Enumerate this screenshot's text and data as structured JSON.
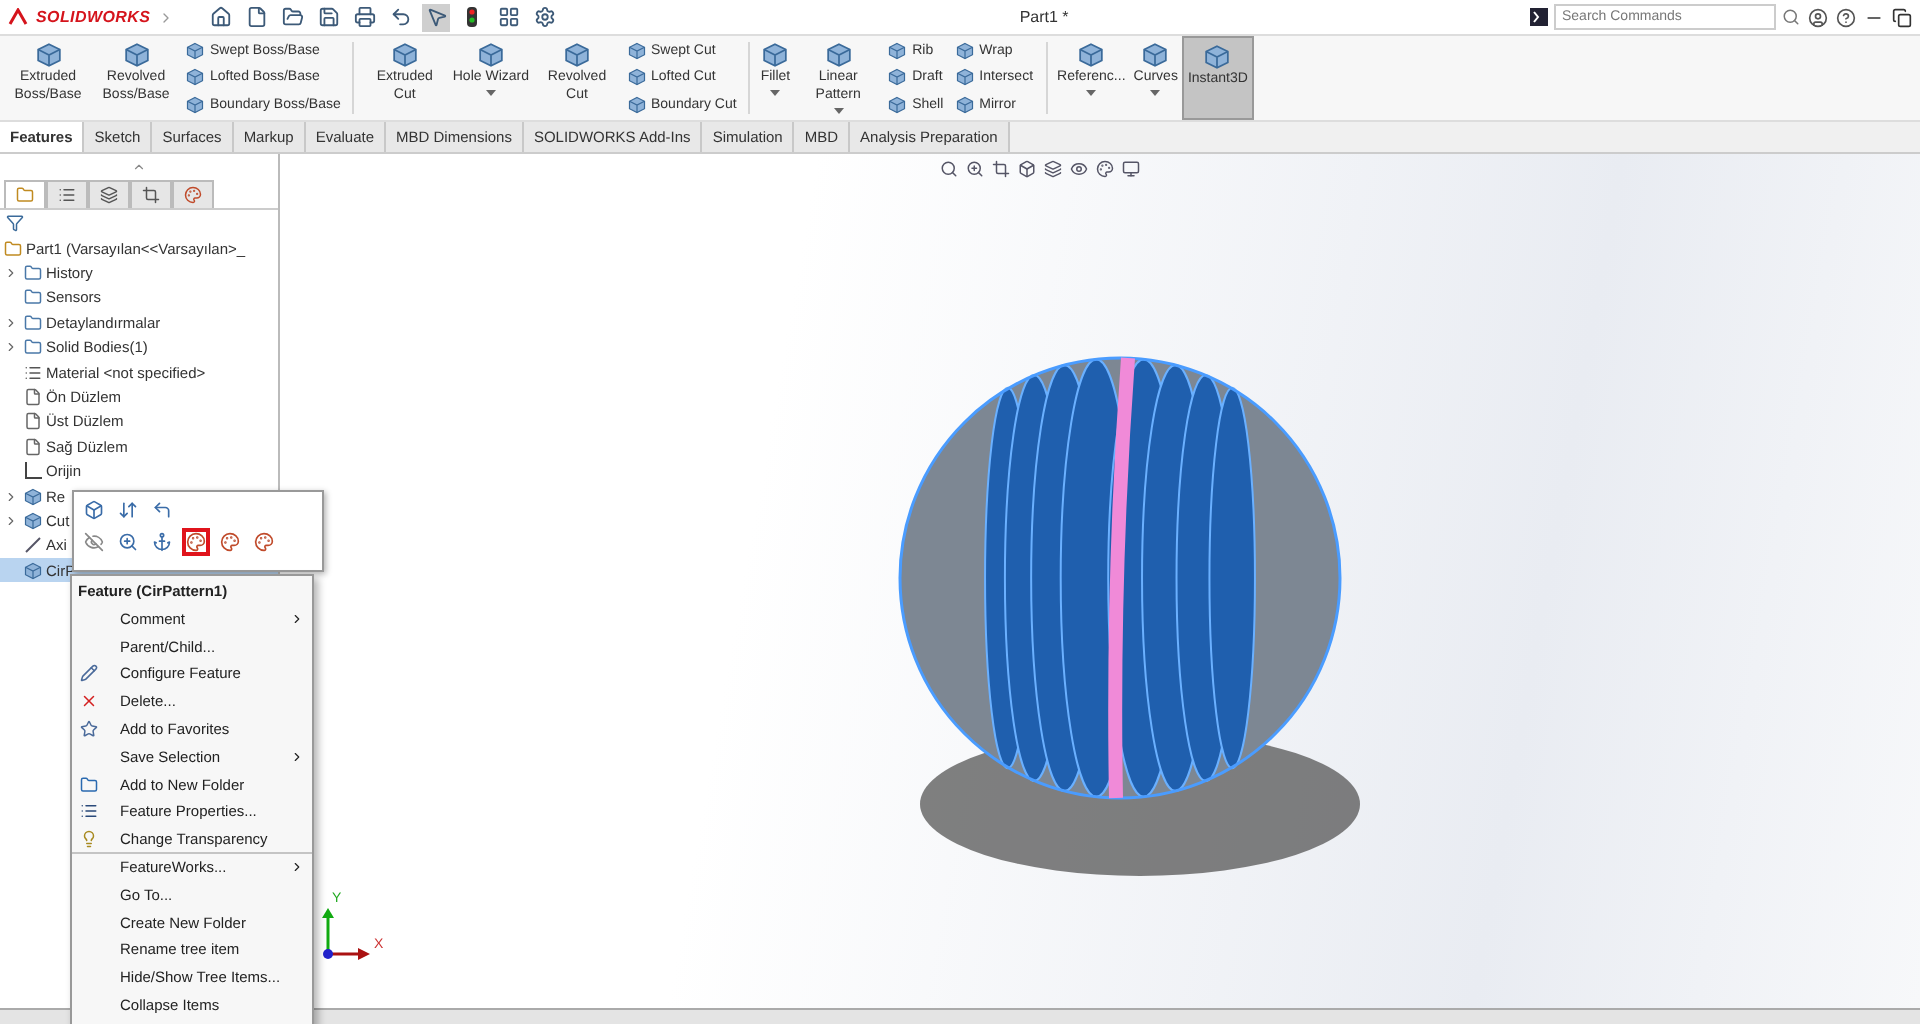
{
  "app": {
    "brand": "SOLIDWORKS",
    "title": "Part1 *",
    "search": {
      "placeholder": "Search Commands"
    }
  },
  "quick_access": [
    {
      "kind": "home",
      "selected": false
    },
    {
      "kind": "new",
      "selected": false
    },
    {
      "kind": "open",
      "selected": false
    },
    {
      "kind": "save",
      "selected": false
    },
    {
      "kind": "print",
      "selected": false
    },
    {
      "kind": "undo",
      "selected": false
    },
    {
      "kind": "pointer",
      "selected": true
    },
    {
      "kind": "rebuild",
      "selected": false
    },
    {
      "kind": "layout",
      "selected": false
    },
    {
      "kind": "options",
      "selected": false
    }
  ],
  "ribbon": [
    {
      "kind": "large",
      "label": "Extruded Boss/Base",
      "dropdown": false,
      "selected": false
    },
    {
      "kind": "large",
      "label": "Revolved Boss/Base",
      "dropdown": false,
      "selected": false
    },
    {
      "kind": "stack",
      "items": [
        "Swept Boss/Base",
        "Lofted Boss/Base",
        "Boundary Boss/Base"
      ]
    },
    {
      "kind": "separator"
    },
    {
      "kind": "large",
      "label": "Extruded Cut",
      "dropdown": false,
      "selected": false
    },
    {
      "kind": "large",
      "label": "Hole Wizard",
      "dropdown": true,
      "selected": false
    },
    {
      "kind": "large",
      "label": "Revolved Cut",
      "dropdown": false,
      "selected": false
    },
    {
      "kind": "stack",
      "items": [
        "Swept Cut",
        "Lofted Cut",
        "Boundary Cut"
      ]
    },
    {
      "kind": "separator"
    },
    {
      "kind": "large",
      "label": "Fillet",
      "dropdown": true,
      "selected": false
    },
    {
      "kind": "large",
      "label": "Linear Pattern",
      "dropdown": true,
      "selected": false
    },
    {
      "kind": "stack",
      "items": [
        "Rib",
        "Draft",
        "Shell"
      ]
    },
    {
      "kind": "stack",
      "items": [
        "Wrap",
        "Intersect",
        "Mirror"
      ]
    },
    {
      "kind": "separator"
    },
    {
      "kind": "large",
      "label": "Referenc...",
      "dropdown": true,
      "selected": false
    },
    {
      "kind": "large",
      "label": "Curves",
      "dropdown": true,
      "selected": false
    },
    {
      "kind": "large",
      "label": "Instant3D",
      "dropdown": false,
      "selected": true
    }
  ],
  "tabs": [
    {
      "label": "Features",
      "selected": true
    },
    {
      "label": "Sketch",
      "selected": false
    },
    {
      "label": "Surfaces",
      "selected": false
    },
    {
      "label": "Markup",
      "selected": false
    },
    {
      "label": "Evaluate",
      "selected": false
    },
    {
      "label": "MBD Dimensions",
      "selected": false
    },
    {
      "label": "SOLIDWORKS Add-Ins",
      "selected": false
    },
    {
      "label": "Simulation",
      "selected": false
    },
    {
      "label": "MBD",
      "selected": false
    },
    {
      "label": "Analysis Preparation",
      "selected": false
    }
  ],
  "tree": {
    "panel_tabs": [
      {
        "selected": true
      },
      {
        "selected": false
      },
      {
        "selected": false
      },
      {
        "selected": false
      },
      {
        "selected": false
      }
    ],
    "root": "Part1  (Varsayılan<<Varsayılan>_",
    "items": [
      {
        "label": "History",
        "kind": "folder",
        "expandable": true,
        "selected": false
      },
      {
        "label": "Sensors",
        "kind": "folder",
        "expandable": false,
        "selected": false
      },
      {
        "label": "Detaylandırmalar",
        "kind": "folder",
        "expandable": true,
        "selected": false
      },
      {
        "label": "Solid Bodies(1)",
        "kind": "folder",
        "expandable": true,
        "selected": false
      },
      {
        "label": "Material <not specified>",
        "kind": "material",
        "expandable": false,
        "selected": false
      },
      {
        "label": "Ön Düzlem",
        "kind": "plane",
        "expandable": false,
        "selected": false
      },
      {
        "label": "Üst Düzlem",
        "kind": "plane",
        "expandable": false,
        "selected": false
      },
      {
        "label": "Sağ Düzlem",
        "kind": "plane",
        "expandable": false,
        "selected": false
      },
      {
        "label": "Orijin",
        "kind": "origin",
        "expandable": false,
        "selected": false
      },
      {
        "label": "Re",
        "kind": "feature",
        "expandable": true,
        "selected": false
      },
      {
        "label": "Cut",
        "kind": "feature",
        "expandable": true,
        "selected": false
      },
      {
        "label": "Axi",
        "kind": "axis",
        "expandable": false,
        "selected": false
      },
      {
        "label": "CirP",
        "kind": "feature",
        "expandable": false,
        "selected": true
      }
    ]
  },
  "popup_toolbar": [
    [
      {
        "kind": "cube",
        "selected": false
      },
      {
        "kind": "sort",
        "selected": false
      },
      {
        "kind": "back",
        "selected": false
      }
    ],
    [
      {
        "kind": "hide",
        "selected": false
      },
      {
        "kind": "zoom",
        "selected": false
      },
      {
        "kind": "anchor",
        "selected": false
      },
      {
        "kind": "appearance",
        "selected": true
      },
      {
        "kind": "appearance",
        "selected": false
      },
      {
        "kind": "appearance",
        "selected": false
      }
    ]
  ],
  "context_menu": {
    "title": "Feature (CirPattern1)",
    "items": [
      {
        "label": "Comment",
        "kind": "none",
        "submenu": true,
        "divider": false
      },
      {
        "label": "Parent/Child...",
        "kind": "none",
        "submenu": false,
        "divider": false
      },
      {
        "label": "Configure Feature",
        "kind": "configure",
        "submenu": false,
        "divider": false
      },
      {
        "label": "Delete...",
        "kind": "delete",
        "submenu": false,
        "divider": false
      },
      {
        "label": "Add to Favorites",
        "kind": "favorite",
        "submenu": false,
        "divider": false
      },
      {
        "label": "Save Selection",
        "kind": "none",
        "submenu": true,
        "divider": false
      },
      {
        "label": "Add to New Folder",
        "kind": "folder",
        "submenu": false,
        "divider": false
      },
      {
        "label": "Feature Properties...",
        "kind": "properties",
        "submenu": false,
        "divider": false
      },
      {
        "label": "Change Transparency",
        "kind": "transparency",
        "submenu": false,
        "divider": false
      },
      {
        "label": "FeatureWorks...",
        "kind": "none",
        "submenu": true,
        "divider": true
      },
      {
        "label": "Go To...",
        "kind": "none",
        "submenu": false,
        "divider": false
      },
      {
        "label": "Create New Folder",
        "kind": "none",
        "submenu": false,
        "divider": false
      },
      {
        "label": "Rename tree item",
        "kind": "none",
        "submenu": false,
        "divider": false
      },
      {
        "label": "Hide/Show Tree Items...",
        "kind": "none",
        "submenu": false,
        "divider": false
      },
      {
        "label": "Collapse Items",
        "kind": "none",
        "submenu": false,
        "divider": false
      }
    ]
  },
  "viewport": {
    "triad": {
      "y": "Y",
      "x": "X"
    }
  }
}
